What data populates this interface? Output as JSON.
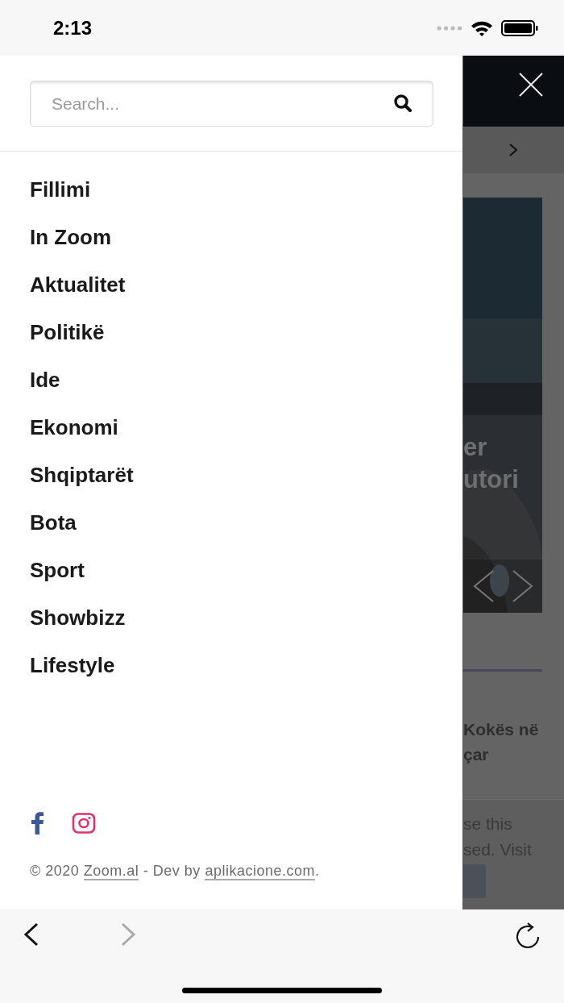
{
  "status_bar": {
    "time": "2:13"
  },
  "search": {
    "placeholder": "Search..."
  },
  "menu": [
    {
      "label": "Fillimi"
    },
    {
      "label": "In Zoom"
    },
    {
      "label": "Aktualitet"
    },
    {
      "label": "Politikë"
    },
    {
      "label": "Ide"
    },
    {
      "label": "Ekonomi"
    },
    {
      "label": "Shqiptarët"
    },
    {
      "label": "Bota"
    },
    {
      "label": "Sport"
    },
    {
      "label": "Showbizz"
    },
    {
      "label": "Lifestyle"
    }
  ],
  "social": [
    {
      "kind": "facebook"
    },
    {
      "kind": "instagram"
    }
  ],
  "footer": {
    "prefix": "© 2020",
    "link_1": "Zoom.al",
    "middle": "- Dev by",
    "link_2": "aplikacione.com",
    "suffix": "."
  },
  "background_page": {
    "headline": [
      "er",
      "utori"
    ],
    "article_title": [
      "Kokës në",
      "çar"
    ],
    "notice": [
      "se this",
      "sed. Visit"
    ]
  },
  "browser_toolbar": {
    "back": {
      "disabled": false
    },
    "forward": {
      "disabled": true
    }
  }
}
